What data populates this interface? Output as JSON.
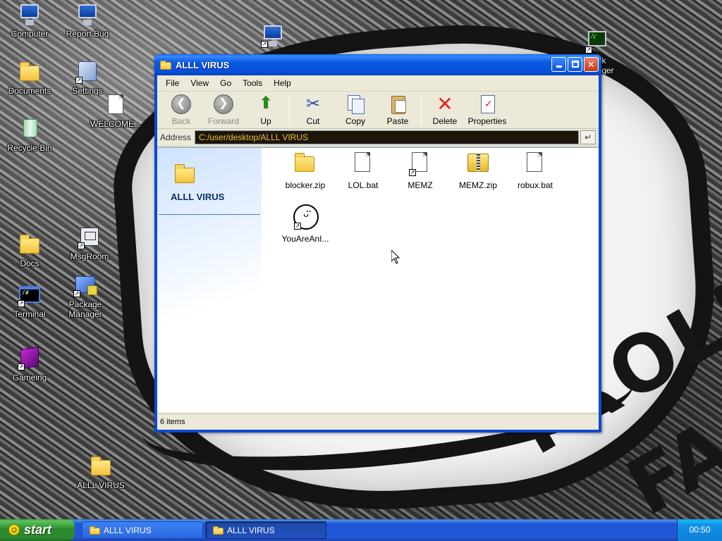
{
  "desktop": {
    "wallpaper_text": [
      "TROLL",
      "FA"
    ],
    "icons": [
      {
        "label": "Computer",
        "icon": "computer-icon"
      },
      {
        "label": "Report Bug",
        "icon": "report-bug-icon"
      },
      {
        "label": "Documents",
        "icon": "documents-icon"
      },
      {
        "label": "Settings",
        "icon": "settings-icon"
      },
      {
        "label": "WELCOME...",
        "icon": "document-icon"
      },
      {
        "label": "Recycle Bin",
        "icon": "recycle-bin-icon"
      },
      {
        "label": "Docs",
        "icon": "folder-icon"
      },
      {
        "label": "MsgRoom",
        "icon": "msgroom-icon"
      },
      {
        "label": "Terminal",
        "icon": "terminal-icon"
      },
      {
        "label": "Package Manager",
        "icon": "package-manager-icon"
      },
      {
        "label": "Gameing",
        "icon": "cube-icon"
      },
      {
        "label": "ALLL VIRUS",
        "icon": "folder-icon"
      },
      {
        "label": "Task Manager",
        "icon": "task-manager-icon"
      }
    ]
  },
  "window": {
    "title": "ALLL VIRUS",
    "buttons": {
      "minimize": "minimize",
      "maximize": "maximize",
      "close": "✕"
    },
    "menu": [
      "File",
      "View",
      "Go",
      "Tools",
      "Help"
    ],
    "toolbar": [
      {
        "label": "Back",
        "icon": "back-arrow-icon",
        "enabled": false
      },
      {
        "label": "Forward",
        "icon": "forward-arrow-icon",
        "enabled": false
      },
      {
        "label": "Up",
        "icon": "up-folder-icon",
        "enabled": true
      },
      {
        "label": "Cut",
        "icon": "scissors-icon",
        "enabled": true
      },
      {
        "label": "Copy",
        "icon": "copy-icon",
        "enabled": true
      },
      {
        "label": "Paste",
        "icon": "paste-icon",
        "enabled": true
      },
      {
        "label": "Delete",
        "icon": "delete-x-icon",
        "enabled": true
      },
      {
        "label": "Properties",
        "icon": "properties-icon",
        "enabled": true
      }
    ],
    "address": {
      "label": "Address",
      "value": "C:/user/desktop/ALLL VIRUS",
      "go": "↵"
    },
    "task_pane": {
      "title": "ALLL VIRUS"
    },
    "files": [
      {
        "name": "blocker.zip",
        "type": "zip-folder",
        "shortcut": false
      },
      {
        "name": "LOL.bat",
        "type": "document",
        "shortcut": false
      },
      {
        "name": "MEMZ",
        "type": "document",
        "shortcut": true
      },
      {
        "name": "MEMZ.zip",
        "type": "zip-folder",
        "shortcut": false
      },
      {
        "name": "robux.bat",
        "type": "document",
        "shortcut": false
      },
      {
        "name": "YouAreAnI...",
        "type": "smiley",
        "shortcut": true
      }
    ],
    "status": "6 items"
  },
  "taskbar": {
    "start_label": "start",
    "tasks": [
      {
        "label": "ALLL VIRUS",
        "active": false
      },
      {
        "label": "ALLL VIRUS",
        "active": true
      }
    ],
    "clock": "00:50"
  },
  "colors": {
    "titlebar": "#0a58e0",
    "start_button": "#2e8a2e",
    "taskbar": "#2157d7",
    "address_bg": "#1e160a",
    "address_text": "#f0c040"
  }
}
